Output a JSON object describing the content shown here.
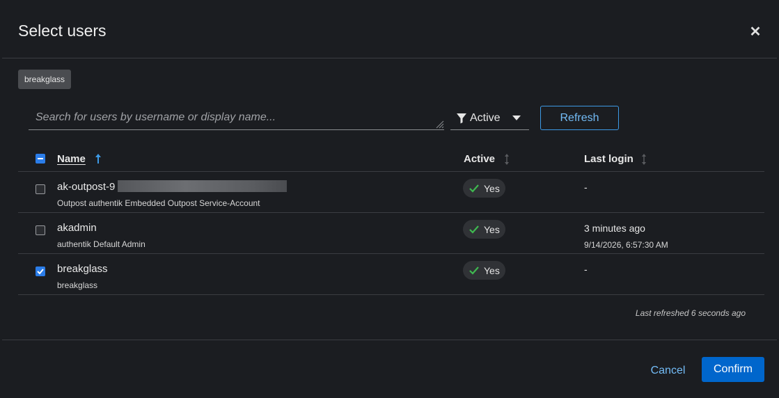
{
  "modal": {
    "title": "Select users",
    "close_icon": "close-icon"
  },
  "selected_chip": {
    "label": "breakglass"
  },
  "toolbar": {
    "search_placeholder": "Search for users by username or display name...",
    "search_value": "",
    "filter_icon": "filter-icon",
    "filter_label": "Active",
    "refresh_label": "Refresh"
  },
  "table": {
    "columns": [
      {
        "label": "Name",
        "sort": "ascending"
      },
      {
        "label": "Active",
        "sort": "none"
      },
      {
        "label": "Last login",
        "sort": "none"
      }
    ],
    "select_all_state": "indeterminate",
    "rows": [
      {
        "username": "ak-outpost-9",
        "name_redacted": true,
        "display_name": "Outpost authentik Embedded Outpost Service-Account",
        "active": "Yes",
        "last_login": "-",
        "last_login_detail": "",
        "checked": false
      },
      {
        "username": "akadmin",
        "name_redacted": false,
        "display_name": "authentik Default Admin",
        "active": "Yes",
        "last_login": "3 minutes ago",
        "last_login_detail": "9/14/2026, 6:57:30 AM",
        "checked": false
      },
      {
        "username": "breakglass",
        "name_redacted": false,
        "display_name": "breakglass",
        "active": "Yes",
        "last_login": "-",
        "last_login_detail": "",
        "checked": true
      }
    ]
  },
  "status": {
    "last_refreshed": "Last refreshed 6 seconds ago"
  },
  "footer": {
    "cancel_label": "Cancel",
    "confirm_label": "Confirm"
  },
  "colors": {
    "background": "#1b1d21",
    "accent": "#0066cc",
    "link": "#73bcf7",
    "success": "#3fb950",
    "checkbox_checked": "#2b7de9"
  }
}
